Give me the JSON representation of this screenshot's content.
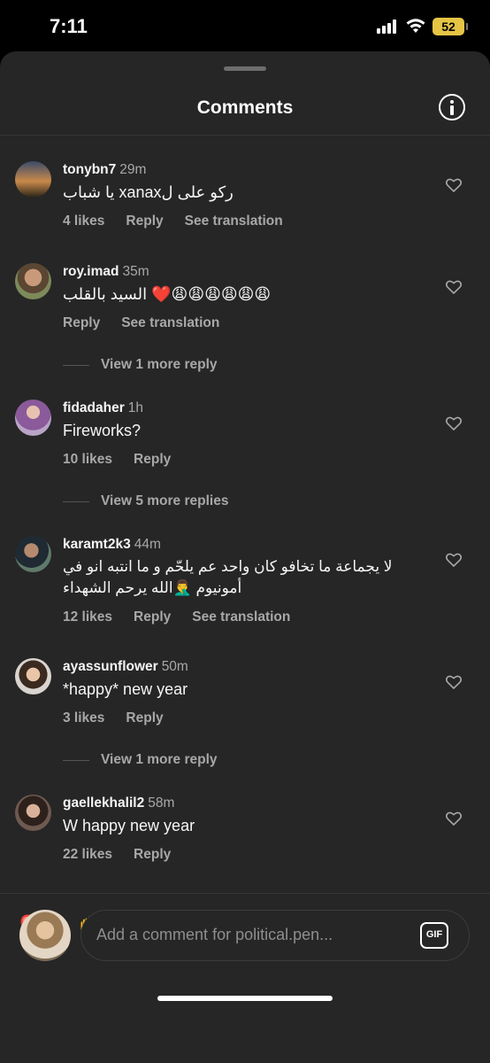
{
  "status_bar": {
    "time": "7:11",
    "battery": "52"
  },
  "header": {
    "title": "Comments"
  },
  "comments": [
    {
      "user": "tonybn7",
      "time": "29m",
      "text": "ركو على لxanax يا شباب",
      "likes": "4 likes",
      "reply": "Reply",
      "translation": "See translation"
    },
    {
      "user": "roy.imad",
      "time": "35m",
      "text": "😩😩😩😩😩😩❤️ السيد بالقلب",
      "reply": "Reply",
      "translation": "See translation",
      "more_replies": "View 1 more reply"
    },
    {
      "user": "fidadaher",
      "time": "1h",
      "text": "Fireworks?",
      "likes": "10 likes",
      "reply": "Reply",
      "more_replies": "View 5 more replies"
    },
    {
      "user": "karamt2k3",
      "time": "44m",
      "text_line1": "لا يجماعة ما تخافو كان واحد عم يلحّم و ما انتبه انو في",
      "text_line2": "أمونيوم 🤦‍♂️الله يرحم الشهداء",
      "likes": "12 likes",
      "reply": "Reply",
      "translation": "See translation"
    },
    {
      "user": "ayassunflower",
      "time": "50m",
      "text": "*happy* new year",
      "likes": "3 likes",
      "reply": "Reply",
      "more_replies": "View 1 more reply"
    },
    {
      "user": "gaellekhalil2",
      "time": "58m",
      "text": "W happy new year",
      "likes": "22 likes",
      "reply": "Reply"
    }
  ],
  "emoji_bar": [
    "❤️",
    "🙌",
    "🔥",
    "👏",
    "😢",
    "😍",
    "😮",
    "😂"
  ],
  "composer": {
    "placeholder": "Add a comment for political.pen...",
    "gif_label": "GIF"
  }
}
